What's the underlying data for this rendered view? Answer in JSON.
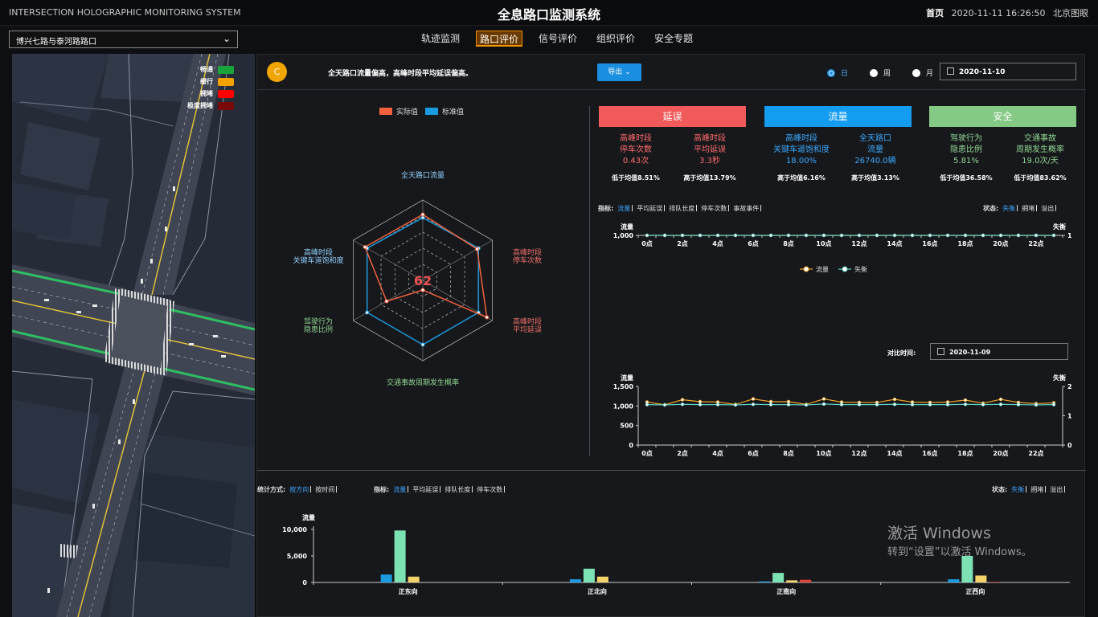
{
  "header": {
    "title_en": "INTERSECTION HOLOGRAPHIC MONITORING SYSTEM",
    "title_cn": "全息路口监测系统",
    "home": "首页",
    "datetime": "2020-11-11 16:26:50",
    "map_provider": "北京图眼"
  },
  "intersection_select": {
    "value": "博兴七路与泰河路路口"
  },
  "nav": {
    "tabs": [
      "轨迹监测",
      "路口评价",
      "信号评价",
      "组织评价",
      "安全专题"
    ],
    "active": 1
  },
  "map_legend": [
    {
      "label": "畅通",
      "color": "#1aa33a"
    },
    {
      "label": "缓行",
      "color": "#f2a100"
    },
    {
      "label": "拥堵",
      "color": "#ff0000"
    },
    {
      "label": "极度拥堵",
      "color": "#7a0a0a"
    }
  ],
  "panel_header": {
    "grade": "C",
    "summary": "全天路口流量偏高，高峰时段平均延误偏高。",
    "export_label": "导出",
    "period_options": [
      "日",
      "周",
      "月"
    ],
    "period_selected": "日",
    "date": "2020-11-10"
  },
  "radar": {
    "legend": [
      {
        "label": "实际值",
        "color": "#f0613d"
      },
      {
        "label": "标准值",
        "color": "#1a9be0"
      }
    ],
    "score": "62",
    "axes": [
      {
        "label1": "全天路口流量",
        "label2": "",
        "color": "#8fd1ff"
      },
      {
        "label1": "高峰时段",
        "label2": "停车次数",
        "color": "#f0706a"
      },
      {
        "label1": "高峰时段",
        "label2": "平均延误",
        "color": "#f0706a"
      },
      {
        "label1": "交通事故周期发生概率",
        "label2": "",
        "color": "#8fd693"
      },
      {
        "label1": "驾驶行为",
        "label2": "隐患比例",
        "color": "#8fd693"
      },
      {
        "label1": "高峰时段",
        "label2": "关键车道饱和度",
        "color": "#8fd1ff"
      }
    ],
    "actual": [
      0.82,
      0.78,
      0.92,
      0.12,
      0.52,
      0.83
    ],
    "standard": [
      0.78,
      0.8,
      0.8,
      0.8,
      0.8,
      0.8
    ]
  },
  "kpis": [
    {
      "title": "延误",
      "bg": "#f05a5a",
      "color": "#ff6b6b",
      "items": [
        {
          "l1": "高峰时段",
          "l2": "停车次数",
          "val": "0.43次",
          "cmp": "低于均值8.51%"
        },
        {
          "l1": "高峰时段",
          "l2": "平均延误",
          "val": "3.3秒",
          "cmp": "高于均值13.79%"
        }
      ]
    },
    {
      "title": "流量",
      "bg": "#139cf0",
      "color": "#3aa8ff",
      "items": [
        {
          "l1": "高峰时段",
          "l2": "关键车道饱和度",
          "val": "18.00%",
          "cmp": "高于均值6.16%"
        },
        {
          "l1": "全天路口",
          "l2": "流量",
          "val": "26740.0辆",
          "cmp": "高于均值3.13%"
        }
      ]
    },
    {
      "title": "安全",
      "bg": "#84c984",
      "color": "#8fd693",
      "items": [
        {
          "l1": "驾驶行为",
          "l2": "隐患比例",
          "val": "5.81%",
          "cmp": "低于均值36.58%"
        },
        {
          "l1": "交通事故",
          "l2": "周期发生概率",
          "val": "19.0次/天",
          "cmp": "低于均值83.62%"
        }
      ]
    }
  ],
  "mid_filters": {
    "metric_label": "指标:",
    "metrics": [
      "流量",
      "平均延误",
      "排队长度",
      "停车次数",
      "事故事件"
    ],
    "metric_on": "流量",
    "state_label": "状态:",
    "states": [
      "失衡",
      "拥堵",
      "溢出"
    ],
    "state_on": "失衡"
  },
  "compare": {
    "label": "对比时间:",
    "date": "2020-11-09"
  },
  "bottom_filters": {
    "stat_label": "统计方式:",
    "stats": [
      "按方向",
      "按时间"
    ],
    "stat_on": "按方向",
    "metric_label": "指标:",
    "metrics": [
      "流量",
      "平均延误",
      "排队长度",
      "停车次数"
    ],
    "metric_on": "流量",
    "state_label": "状态:",
    "states": [
      "失衡",
      "拥堵",
      "溢出"
    ],
    "state_on": "失衡"
  },
  "chart_data": [
    {
      "type": "line",
      "ylabel": "流量",
      "y2label": "失衡",
      "categories": [
        "0点",
        "2点",
        "4点",
        "6点",
        "8点",
        "10点",
        "12点",
        "14点",
        "16点",
        "18点",
        "20点",
        "22点"
      ],
      "yticks_left": [
        "1,000"
      ],
      "yticks_right": [
        "1"
      ],
      "legend": [
        "流量",
        "失衡"
      ],
      "series": [
        {
          "name": "流量",
          "color": "#f5a623",
          "values": [
            1000,
            1000,
            1000,
            1000,
            1000,
            1000,
            1000,
            1000,
            1000,
            1000,
            1000,
            1000,
            1000,
            1000,
            1000,
            1000,
            1000,
            1000,
            1000,
            1000,
            1000,
            1000,
            1000,
            1000
          ]
        },
        {
          "name": "失衡",
          "color": "#5cd0c8",
          "values": [
            1,
            1,
            1,
            1,
            1,
            1,
            1,
            1,
            1,
            1,
            1,
            1,
            1,
            1,
            1,
            1,
            1,
            1,
            1,
            1,
            1,
            1,
            1,
            1
          ]
        }
      ]
    },
    {
      "type": "line",
      "ylabel": "流量",
      "y2label": "失衡",
      "categories": [
        "0点",
        "2点",
        "4点",
        "6点",
        "8点",
        "10点",
        "12点",
        "14点",
        "16点",
        "18点",
        "20点",
        "22点"
      ],
      "ylim": [
        0,
        1500
      ],
      "yticks_left": [
        "0",
        "500",
        "1,000",
        "1,500"
      ],
      "y2lim": [
        0,
        2
      ],
      "yticks_right": [
        "0",
        "1",
        "2"
      ],
      "series": [
        {
          "name": "流量",
          "color": "#f5a623",
          "values": [
            1100,
            1030,
            1160,
            1110,
            1100,
            1040,
            1180,
            1110,
            1110,
            1040,
            1180,
            1100,
            1090,
            1090,
            1170,
            1100,
            1090,
            1100,
            1150,
            1070,
            1170,
            1090,
            1060,
            1080
          ]
        },
        {
          "name": "失衡",
          "color": "#5cd0c8",
          "values": [
            1.38,
            1.37,
            1.39,
            1.38,
            1.38,
            1.37,
            1.39,
            1.38,
            1.38,
            1.37,
            1.4,
            1.38,
            1.38,
            1.38,
            1.39,
            1.38,
            1.38,
            1.38,
            1.39,
            1.38,
            1.39,
            1.38,
            1.37,
            1.38
          ]
        }
      ]
    },
    {
      "type": "bar",
      "ylabel": "流量",
      "categories": [
        "正东向",
        "正北向",
        "正南向",
        "正西向"
      ],
      "ylim": [
        0,
        10000
      ],
      "yticks": [
        "0",
        "5,000",
        "10,000"
      ],
      "series": [
        {
          "color": "#1a9be0",
          "values": [
            1500,
            600,
            200,
            600
          ]
        },
        {
          "color": "#7de2b3",
          "values": [
            9800,
            2600,
            1800,
            5000
          ]
        },
        {
          "color": "#f5d36a",
          "values": [
            1100,
            1100,
            400,
            1300
          ]
        },
        {
          "color": "#e0453a",
          "values": [
            0,
            0,
            500,
            100
          ]
        }
      ]
    }
  ],
  "watermark": {
    "line1": "激活 Windows",
    "line2": "转到“设置”以激活 Windows。"
  }
}
